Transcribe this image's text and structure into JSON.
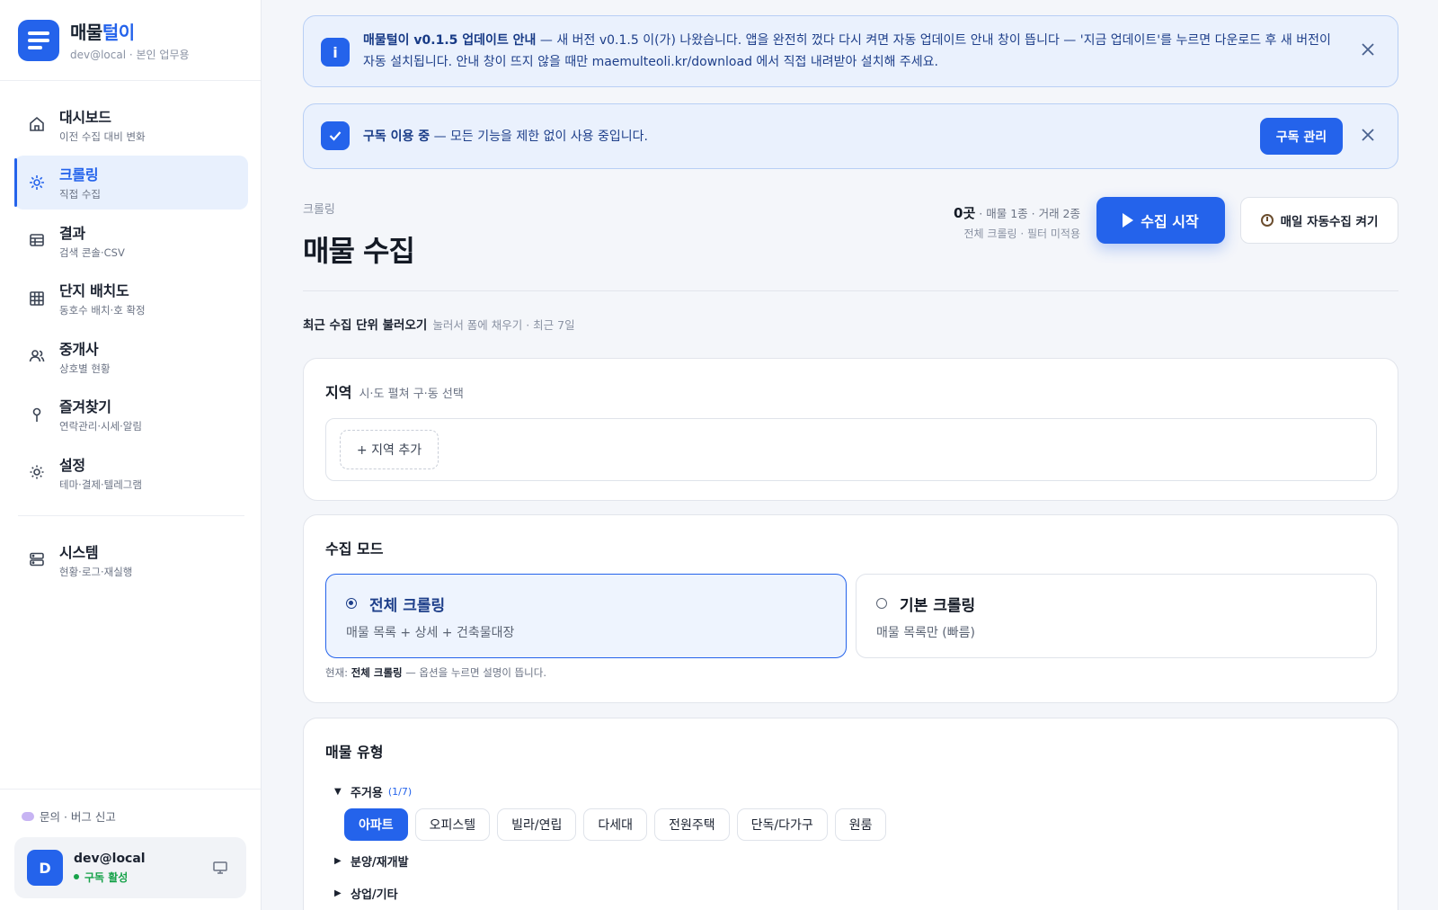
{
  "brand": {
    "title_main": "매물",
    "title_accent": "털이",
    "sub": "dev@local · 본인 업무용"
  },
  "nav": {
    "items": [
      {
        "label": "대시보드",
        "sub": "이전 수집 대비 변화",
        "icon": "home-icon"
      },
      {
        "label": "크롤링",
        "sub": "직접 수집",
        "icon": "sparkle-icon",
        "active": true
      },
      {
        "label": "결과",
        "sub": "검색 콘솔·CSV",
        "icon": "table-icon"
      },
      {
        "label": "단지 배치도",
        "sub": "동호수 배치·호 확정",
        "icon": "grid-icon"
      },
      {
        "label": "중개사",
        "sub": "상호별 현황",
        "icon": "users-icon"
      },
      {
        "label": "즐겨찾기",
        "sub": "연락관리·시세·알림",
        "icon": "pin-icon"
      },
      {
        "label": "설정",
        "sub": "테마·결제·텔레그램",
        "icon": "gear-icon"
      }
    ],
    "system": {
      "label": "시스템",
      "sub": "현황·로그·재실행",
      "icon": "server-icon"
    }
  },
  "footer": {
    "feedback": "문의 · 버그 신고",
    "user_initial": "D",
    "user_name": "dev@local",
    "user_status": "구독 활성"
  },
  "banners": {
    "update": {
      "title": "매물털이 v0.1.5 업데이트 안내",
      "body": " — 새 버전 v0.1.5 이(가) 나왔습니다. 앱을 완전히 껐다 다시 켜면 자동 업데이트 안내 창이 뜹니다 — '지금 업데이트'를 누르면 다운로드 후 새 버전이 자동 설치됩니다. 안내 창이 뜨지 않을 때만 ",
      "link": "maemulteoli.kr/download",
      "tail": " 에서 직접 내려받아 설치해 주세요."
    },
    "subscription": {
      "title": "구독 이용 중",
      "body": " — 모든 기능을 제한 없이 사용 중입니다.",
      "button": "구독 관리"
    }
  },
  "header": {
    "crumb": "크롤링",
    "title": "매물 수집",
    "stats_count": "0곳",
    "stats_rest": " · 매물 1종 · 거래 2종",
    "stats_line2": "전체 크롤링 · 필터 미적용",
    "start_label": "수집 시작",
    "auto_label": "매일 자동수집 켜기"
  },
  "recent": {
    "label": "최근 수집 단위 불러오기",
    "hint": "눌러서 폼에 채우기 · 최근 7일"
  },
  "region": {
    "title": "지역",
    "hint": "시·도 펼쳐 구·동 선택",
    "add_label": "+ 지역 추가"
  },
  "mode": {
    "title": "수집 모드",
    "options": [
      {
        "name": "전체 크롤링",
        "desc": "매물 목록 + 상세 + 건축물대장",
        "selected": true
      },
      {
        "name": "기본 크롤링",
        "desc": "매물 목록만 (빠름)",
        "selected": false
      }
    ],
    "note_prefix": "현재: ",
    "note_current": "전체 크롤링",
    "note_suffix": " — 옵션을 누르면 설명이 뜹니다."
  },
  "types": {
    "title": "매물 유형",
    "groups": [
      {
        "label": "주거용",
        "count": "(1/7)",
        "expanded": true
      },
      {
        "label": "분양/재개발",
        "expanded": false
      },
      {
        "label": "상업/기타",
        "expanded": false
      }
    ],
    "chips": [
      {
        "label": "아파트",
        "on": true
      },
      {
        "label": "오피스텔",
        "on": false
      },
      {
        "label": "빌라/연립",
        "on": false
      },
      {
        "label": "다세대",
        "on": false
      },
      {
        "label": "전원주택",
        "on": false
      },
      {
        "label": "단독/다가구",
        "on": false
      },
      {
        "label": "원룸",
        "on": false
      }
    ]
  },
  "colors": {
    "accent": "#2463eb",
    "success": "#17a24a",
    "banner_bg": "#eaf1fd"
  }
}
